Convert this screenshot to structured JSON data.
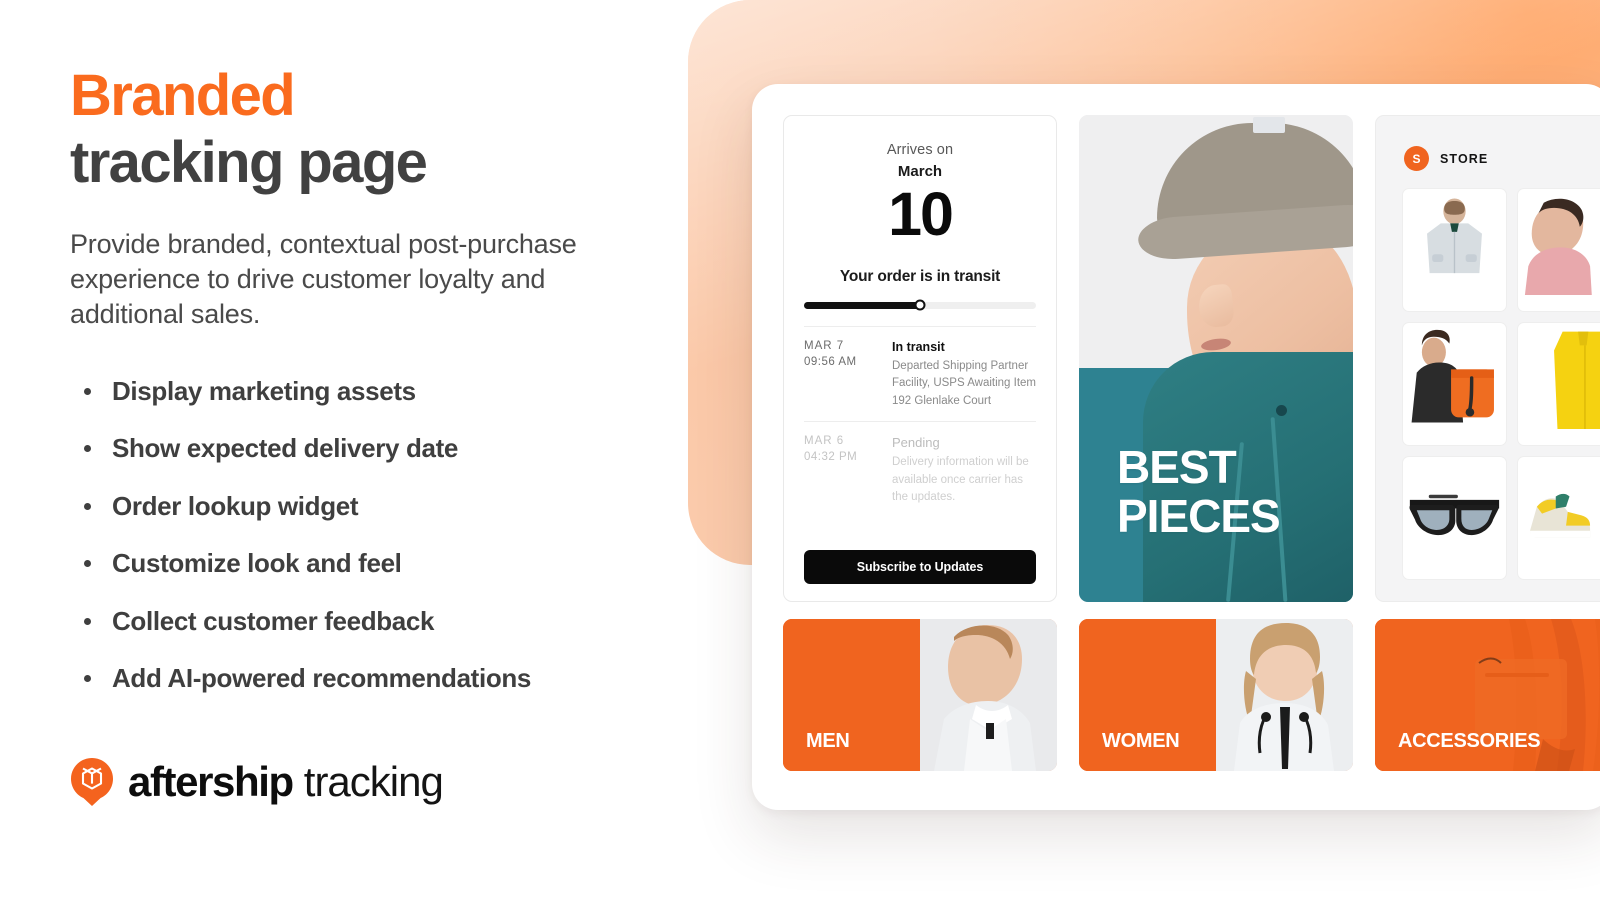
{
  "hero": {
    "headline_accent": "Branded",
    "headline_rest": "tracking page",
    "subhead": "Provide branded, contextual post-purchase experience to drive customer loyalty and additional sales.",
    "accent_color": "#FA6B1E",
    "text_color": "#3f3f3f"
  },
  "features": [
    {
      "label": "Display marketing assets"
    },
    {
      "label": "Show expected delivery date"
    },
    {
      "label": "Order lookup widget"
    },
    {
      "label": "Customize look and feel"
    },
    {
      "label": "Collect customer feedback"
    },
    {
      "label": "Add AI-powered recommendations"
    }
  ],
  "logo": {
    "icon": "aftership-package-pin-icon",
    "brand": "aftership",
    "product": "tracking",
    "mark_color": "#F4631E"
  },
  "tracking_card": {
    "arrives_label": "Arrives on",
    "arrives_month": "March",
    "arrives_day": "10",
    "status": "Your order is in transit",
    "progress_percent": 50,
    "events": [
      {
        "date": "MAR 7",
        "time": "09:56 AM",
        "title": "In transit",
        "description": "Departed Shipping Partner Facility, USPS Awaiting Item 192 Glenlake Court",
        "state": "active"
      },
      {
        "date": "MAR 6",
        "time": "04:32 PM",
        "title": "Pending",
        "description": "Delivery information will be available once carrier has the updates.",
        "state": "pending"
      }
    ],
    "subscribe_label": "Subscribe to Updates"
  },
  "promo_card": {
    "line1": "BEST",
    "line2": "PIECES",
    "background_color": "#2E8291"
  },
  "store_card": {
    "avatar_letter": "S",
    "name": "STORE",
    "avatar_color": "#F0641F",
    "thumbnails": [
      {
        "name": "grey-anorak-jacket"
      },
      {
        "name": "pink-shirt-portrait"
      },
      {
        "name": "orange-backpack-model"
      },
      {
        "name": "yellow-raincoat"
      },
      {
        "name": "black-sunglasses"
      },
      {
        "name": "yellow-sneakers"
      }
    ]
  },
  "categories": [
    {
      "label": "MEN",
      "style": "split",
      "photo": "male-model-white-jacket"
    },
    {
      "label": "WOMEN",
      "style": "split",
      "photo": "female-model-white-jacket"
    },
    {
      "label": "ACCESSORIES",
      "style": "full",
      "photo": "orange-fabric-bag"
    }
  ],
  "colors": {
    "brand_orange": "#F0641F",
    "headline_orange": "#FA6B1E",
    "teal": "#2E8291",
    "panel_bg": "#FFFFFF"
  }
}
